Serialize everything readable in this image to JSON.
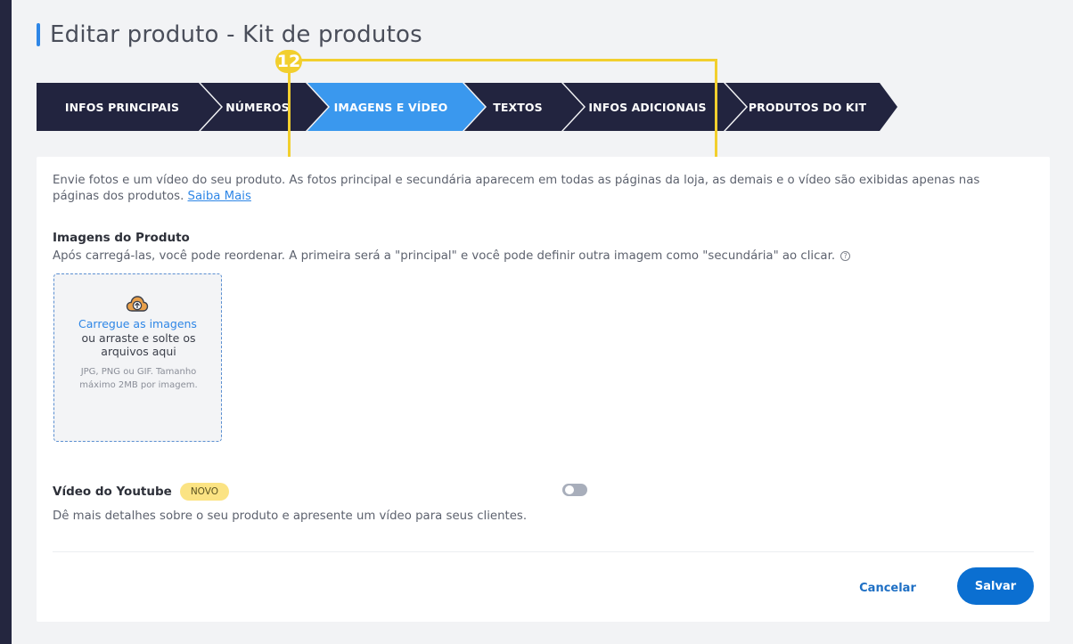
{
  "page": {
    "title": "Editar produto - Kit de produtos"
  },
  "steps": [
    {
      "label": "INFOS PRINCIPAIS",
      "active": false
    },
    {
      "label": "NÚMEROS",
      "active": false
    },
    {
      "label": "IMAGENS E VÍDEO",
      "active": true
    },
    {
      "label": "TEXTOS",
      "active": false
    },
    {
      "label": "INFOS ADICIONAIS",
      "active": false
    },
    {
      "label": "PRODUTOS DO KIT",
      "active": false
    }
  ],
  "annotation": {
    "number": "12",
    "color": "#f2cf2e"
  },
  "intro": {
    "text": "Envie fotos e um vídeo do seu produto. As fotos principal e secundária aparecem em todas as páginas da loja, as demais e o vídeo são exibidas apenas nas páginas dos produtos. ",
    "link": "Saiba Mais"
  },
  "images_section": {
    "title": "Imagens do Produto",
    "description": "Após carregá-las, você pode reordenar. A primeira será a \"principal\" e você pode definir outra imagem como \"secundária\" ao clicar.",
    "help_icon": "question-circle-icon",
    "dropzone": {
      "link": "Carregue as imagens",
      "text": "ou arraste e solte os arquivos aqui",
      "hint": "JPG, PNG ou GIF. Tamanho máximo 2MB por imagem.",
      "icon": "cloud-upload-icon"
    }
  },
  "video_section": {
    "title": "Vídeo do Youtube",
    "badge": "NOVO",
    "description": "Dê mais detalhes sobre o seu produto e apresente um vídeo para seus clientes.",
    "toggle_on": false
  },
  "actions": {
    "cancel": "Cancelar",
    "save": "Salvar"
  },
  "colors": {
    "step_dark": "#22243f",
    "step_active": "#3a98ee",
    "accent": "#0b6fd1",
    "badge_bg": "#fbe383"
  }
}
